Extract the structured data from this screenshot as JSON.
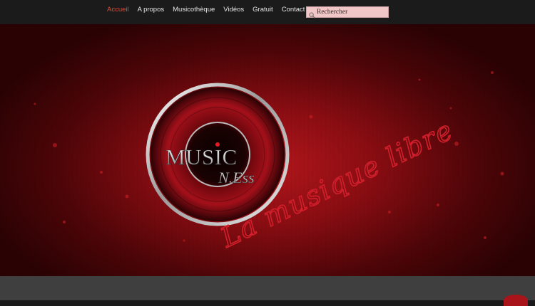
{
  "nav": {
    "items": [
      {
        "label": "Accueil",
        "active": true
      },
      {
        "label": "A propos",
        "active": false
      },
      {
        "label": "Musicothèque",
        "active": false
      },
      {
        "label": "Vidéos",
        "active": false
      },
      {
        "label": "Gratuit",
        "active": false
      },
      {
        "label": "Contact",
        "active": false
      }
    ]
  },
  "search": {
    "placeholder": "Rechercher",
    "icon": "magnifier-icon"
  },
  "hero": {
    "logo_main": "MUSIC",
    "logo_sub": "N.Ess",
    "tagline": "La musique libre"
  },
  "colors": {
    "nav_bg": "#1b1b1b",
    "nav_active": "#d94f3a",
    "nav_text": "#e6e6e6",
    "hero_red": "#b3161b",
    "search_bg": "#f1c6c6",
    "footer": "#3f3f3f"
  }
}
